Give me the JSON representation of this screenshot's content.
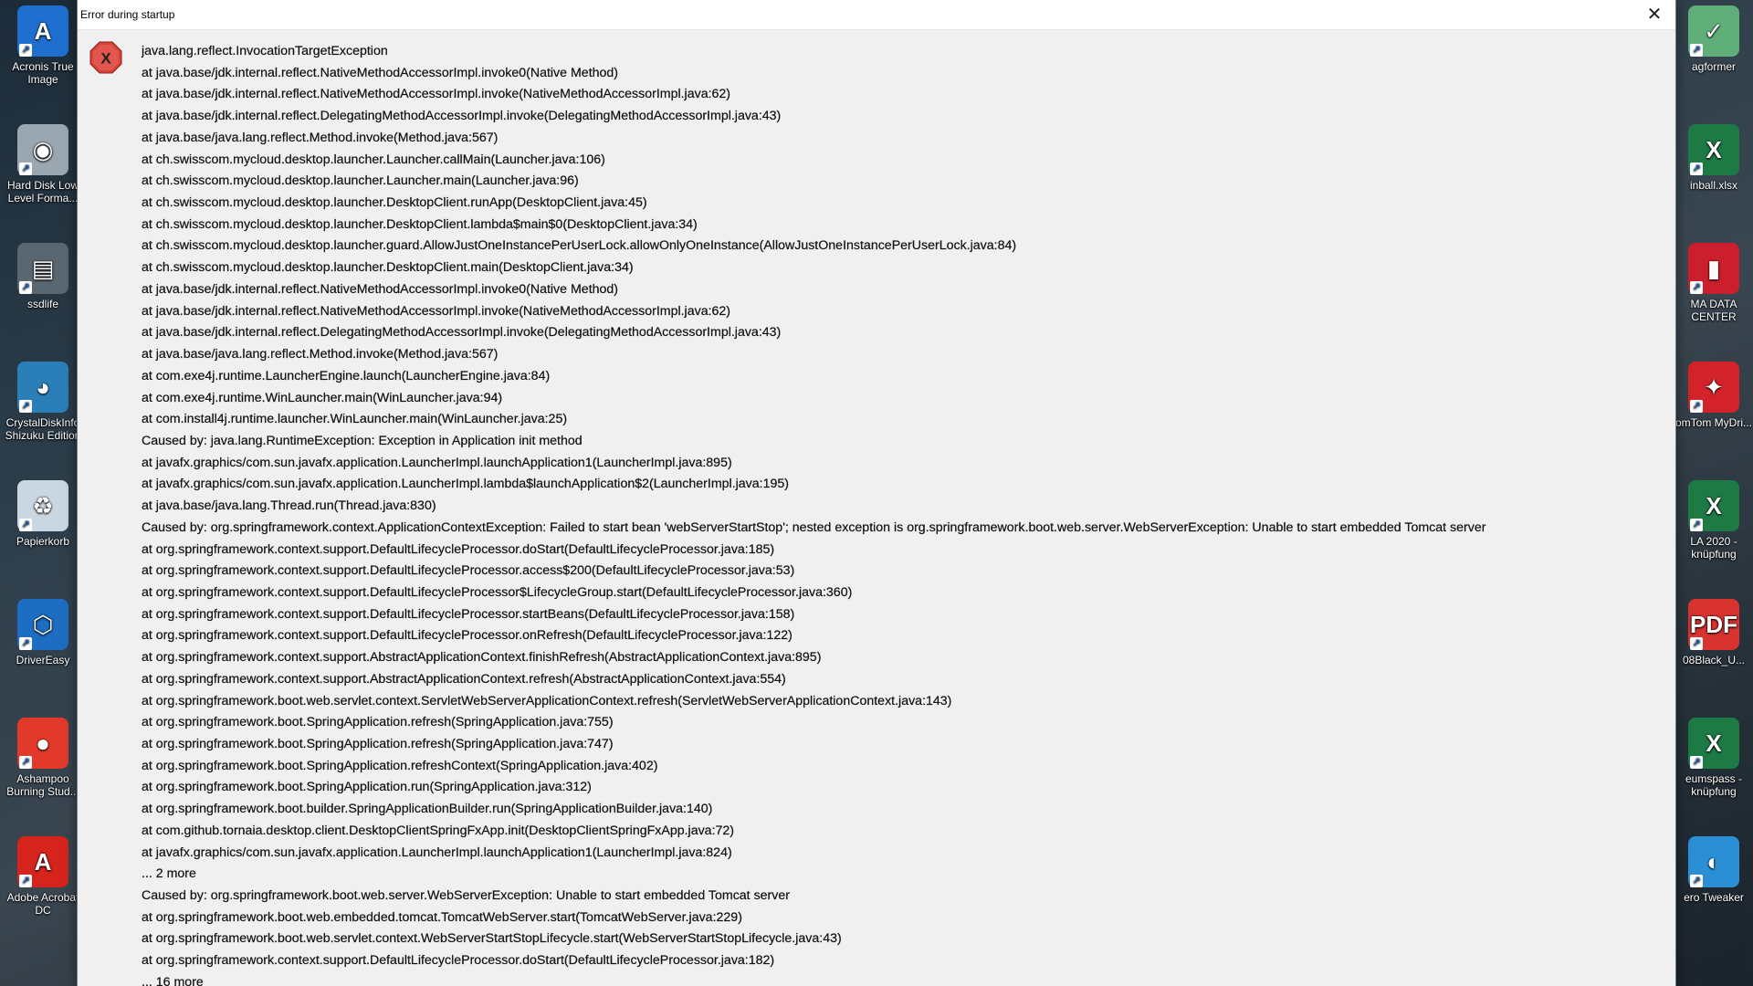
{
  "desktop": {
    "left_icons": [
      {
        "name": "acronis-true-image-icon",
        "label": "Acronis True Image",
        "color": "#1f6fd1",
        "glyph": "A"
      },
      {
        "name": "hard-disk-low-level-format-icon",
        "label": "Hard Disk Low Level Forma...",
        "color": "#9aa6b0",
        "glyph": "◉"
      },
      {
        "name": "ssdlife-icon",
        "label": "ssdlife",
        "color": "#5a6670",
        "glyph": "▤"
      },
      {
        "name": "crystaldiskinfo-icon",
        "label": "CrystalDiskInfo Shizuku Edition",
        "color": "#2a7fb8",
        "glyph": "◕"
      },
      {
        "name": "recycle-bin-icon",
        "label": "Papierkorb",
        "color": "#c9d7e3",
        "glyph": "♻"
      },
      {
        "name": "drivereasy-icon",
        "label": "DriverEasy",
        "color": "#1d6ec2",
        "glyph": "⬡"
      },
      {
        "name": "ashampoo-burning-studio-icon",
        "label": "Ashampoo Burning Stud...",
        "color": "#e23a2a",
        "glyph": "●"
      },
      {
        "name": "adobe-acrobat-icon",
        "label": "Adobe Acrobat DC",
        "color": "#d4241c",
        "glyph": "A"
      }
    ],
    "right_icons": [
      {
        "name": "transformer-icon",
        "label": "agformer",
        "color": "#5fae7a",
        "glyph": "✓"
      },
      {
        "name": "excel-file-icon",
        "label": "inball.xlsx",
        "color": "#1d7a45",
        "glyph": "X"
      },
      {
        "name": "data-center-icon",
        "label": "MA DATA CENTER",
        "color": "#cc1f2d",
        "glyph": "▮"
      },
      {
        "name": "tomtom-mydrive-icon",
        "label": "omTom MyDri...",
        "color": "#d3222a",
        "glyph": "✦"
      },
      {
        "name": "excel-verknuepfung-icon",
        "label": "LA 2020 - knüpfung",
        "color": "#1d7a45",
        "glyph": "X"
      },
      {
        "name": "pdf-file-icon",
        "label": "08Black_U...",
        "color": "#d8332f",
        "glyph": "PDF"
      },
      {
        "name": "excel-saisonpass-icon",
        "label": "eumspass - knüpfung",
        "color": "#1d7a45",
        "glyph": "X"
      },
      {
        "name": "aero-tweaker-icon",
        "label": "ero Tweaker",
        "color": "#2b8fd6",
        "glyph": "◐"
      }
    ]
  },
  "dialog": {
    "title": "Error during startup",
    "close_label": "✕",
    "icon_glyph": "X",
    "icon_color": "#d9423b",
    "trace_lines": [
      "java.lang.reflect.InvocationTargetException",
      "at java.base/jdk.internal.reflect.NativeMethodAccessorImpl.invoke0(Native Method)",
      "at java.base/jdk.internal.reflect.NativeMethodAccessorImpl.invoke(NativeMethodAccessorImpl.java:62)",
      "at java.base/jdk.internal.reflect.DelegatingMethodAccessorImpl.invoke(DelegatingMethodAccessorImpl.java:43)",
      "at java.base/java.lang.reflect.Method.invoke(Method.java:567)",
      "at ch.swisscom.mycloud.desktop.launcher.Launcher.callMain(Launcher.java:106)",
      "at ch.swisscom.mycloud.desktop.launcher.Launcher.main(Launcher.java:96)",
      "at ch.swisscom.mycloud.desktop.launcher.DesktopClient.runApp(DesktopClient.java:45)",
      "at ch.swisscom.mycloud.desktop.launcher.DesktopClient.lambda$main$0(DesktopClient.java:34)",
      "at ch.swisscom.mycloud.desktop.launcher.guard.AllowJustOneInstancePerUserLock.allowOnlyOneInstance(AllowJustOneInstancePerUserLock.java:84)",
      "at ch.swisscom.mycloud.desktop.launcher.DesktopClient.main(DesktopClient.java:34)",
      "at java.base/jdk.internal.reflect.NativeMethodAccessorImpl.invoke0(Native Method)",
      "at java.base/jdk.internal.reflect.NativeMethodAccessorImpl.invoke(NativeMethodAccessorImpl.java:62)",
      "at java.base/jdk.internal.reflect.DelegatingMethodAccessorImpl.invoke(DelegatingMethodAccessorImpl.java:43)",
      "at java.base/java.lang.reflect.Method.invoke(Method.java:567)",
      "at com.exe4j.runtime.LauncherEngine.launch(LauncherEngine.java:84)",
      "at com.exe4j.runtime.WinLauncher.main(WinLauncher.java:94)",
      "at com.install4j.runtime.launcher.WinLauncher.main(WinLauncher.java:25)",
      "Caused by: java.lang.RuntimeException: Exception in Application init method",
      "at javafx.graphics/com.sun.javafx.application.LauncherImpl.launchApplication1(LauncherImpl.java:895)",
      "at javafx.graphics/com.sun.javafx.application.LauncherImpl.lambda$launchApplication$2(LauncherImpl.java:195)",
      "at java.base/java.lang.Thread.run(Thread.java:830)",
      "Caused by: org.springframework.context.ApplicationContextException: Failed to start bean 'webServerStartStop'; nested exception is org.springframework.boot.web.server.WebServerException: Unable to start embedded Tomcat server",
      "at org.springframework.context.support.DefaultLifecycleProcessor.doStart(DefaultLifecycleProcessor.java:185)",
      "at org.springframework.context.support.DefaultLifecycleProcessor.access$200(DefaultLifecycleProcessor.java:53)",
      "at org.springframework.context.support.DefaultLifecycleProcessor$LifecycleGroup.start(DefaultLifecycleProcessor.java:360)",
      "at org.springframework.context.support.DefaultLifecycleProcessor.startBeans(DefaultLifecycleProcessor.java:158)",
      "at org.springframework.context.support.DefaultLifecycleProcessor.onRefresh(DefaultLifecycleProcessor.java:122)",
      "at org.springframework.context.support.AbstractApplicationContext.finishRefresh(AbstractApplicationContext.java:895)",
      "at org.springframework.context.support.AbstractApplicationContext.refresh(AbstractApplicationContext.java:554)",
      "at org.springframework.boot.web.servlet.context.ServletWebServerApplicationContext.refresh(ServletWebServerApplicationContext.java:143)",
      "at org.springframework.boot.SpringApplication.refresh(SpringApplication.java:755)",
      "at org.springframework.boot.SpringApplication.refresh(SpringApplication.java:747)",
      "at org.springframework.boot.SpringApplication.refreshContext(SpringApplication.java:402)",
      "at org.springframework.boot.SpringApplication.run(SpringApplication.java:312)",
      "at org.springframework.boot.builder.SpringApplicationBuilder.run(SpringApplicationBuilder.java:140)",
      "at com.github.tornaia.desktop.client.DesktopClientSpringFxApp.init(DesktopClientSpringFxApp.java:72)",
      "at javafx.graphics/com.sun.javafx.application.LauncherImpl.launchApplication1(LauncherImpl.java:824)",
      "... 2 more",
      "Caused by: org.springframework.boot.web.server.WebServerException: Unable to start embedded Tomcat server",
      "at org.springframework.boot.web.embedded.tomcat.TomcatWebServer.start(TomcatWebServer.java:229)",
      "at org.springframework.boot.web.servlet.context.WebServerStartStopLifecycle.start(WebServerStartStopLifecycle.java:43)",
      "at org.springframework.context.support.DefaultLifecycleProcessor.doStart(DefaultLifecycleProcessor.java:182)",
      "... 16 more"
    ]
  }
}
